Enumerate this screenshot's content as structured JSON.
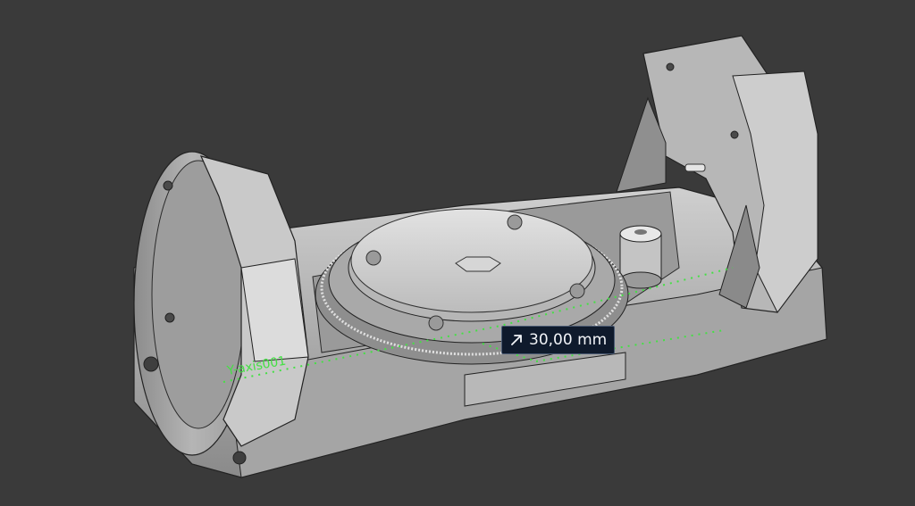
{
  "viewport": {
    "background": "#3a3a3a",
    "model_fill": "#bdbdbd",
    "model_shadow": "#7d7d7d",
    "model_edge": "#222222",
    "axis_color": "#44e044"
  },
  "axis_label": "Y-axis001",
  "measure": {
    "icon": "diagonal-arrow-icon",
    "value": "30,00 mm"
  }
}
